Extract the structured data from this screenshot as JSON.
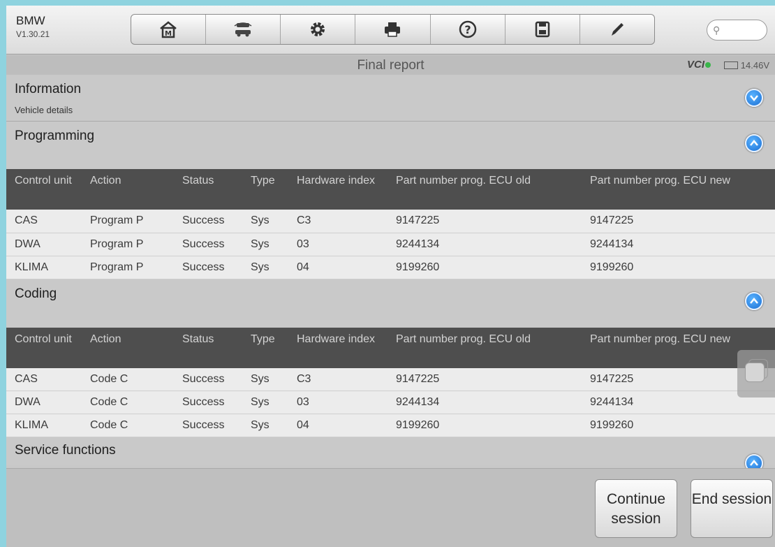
{
  "app": {
    "make": "BMW",
    "version": "V1.30.21"
  },
  "toolbar": {
    "items": [
      "home-icon",
      "vehicle-swap-icon",
      "settings-icon",
      "print-icon",
      "help-icon",
      "save-icon",
      "edit-icon"
    ]
  },
  "search": {
    "placeholder": ""
  },
  "status": {
    "title": "Final report",
    "vci": "VCI",
    "voltage": "14.46V"
  },
  "sections": {
    "information": {
      "title": "Information",
      "subtitle": "Vehicle details"
    },
    "programming": {
      "title": "Programming"
    },
    "coding": {
      "title": "Coding"
    },
    "service": {
      "title": "Service functions"
    }
  },
  "table_headers": {
    "control_unit": "Control unit",
    "action": "Action",
    "status": "Status",
    "type": "Type",
    "hardware_index": "Hardware index",
    "pn_old": "Part number prog. ECU old",
    "pn_new": "Part number prog. ECU new"
  },
  "programming_rows": [
    [
      "CAS",
      "Program P",
      "Success",
      "Sys",
      "C3",
      "9147225",
      "9147225"
    ],
    [
      "DWA",
      "Program P",
      "Success",
      "Sys",
      "03",
      "9244134",
      "9244134"
    ],
    [
      "KLIMA",
      "Program P",
      "Success",
      "Sys",
      "04",
      "9199260",
      "9199260"
    ]
  ],
  "coding_rows": [
    [
      "CAS",
      "Code C",
      "Success",
      "Sys",
      "C3",
      "9147225",
      "9147225"
    ],
    [
      "DWA",
      "Code C",
      "Success",
      "Sys",
      "03",
      "9244134",
      "9244134"
    ],
    [
      "KLIMA",
      "Code C",
      "Success",
      "Sys",
      "04",
      "9199260",
      "9199260"
    ]
  ],
  "buttons": {
    "continue": "Continue session",
    "end": "End session"
  },
  "colors": {
    "accent": "#1a6fd4",
    "header_bg": "#4e4e4e",
    "frame": "#8fd3df"
  }
}
